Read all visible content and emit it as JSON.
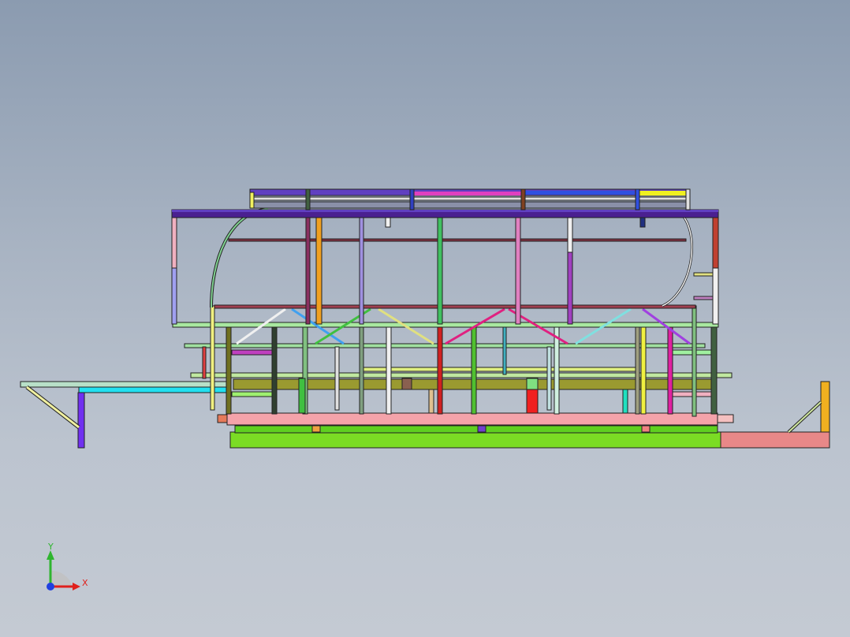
{
  "viewport": {
    "background_top": "#8b9bb0",
    "background_bottom": "#c4cad3"
  },
  "triad": {
    "x_label": "X",
    "y_label": "Y",
    "x_color": "#e0201c",
    "y_color": "#2fb52f",
    "z_color": "#2040e0"
  }
}
